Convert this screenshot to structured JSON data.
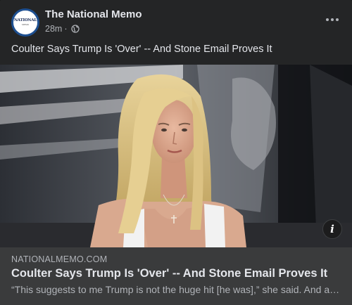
{
  "post": {
    "page_name": "The National Memo",
    "avatar_text": "NATIONAL",
    "avatar_subtext": "MEMO",
    "timestamp": "28m",
    "separator": "·",
    "audience_icon": "globe-icon",
    "more_icon": "more-horizontal-icon",
    "caption": "Coulter Says Trump Is 'Over' -- And Stone Email Proves It"
  },
  "link": {
    "domain": "NATIONALMEMO.COM",
    "title": "Coulter Says Trump Is 'Over' -- And Stone Email Proves It",
    "description": "“This suggests to me Trump is not the huge hit [he was],” she said. And a new email from Roger Stone shows his people know it.",
    "info_icon": "info-icon",
    "image_alt": "Woman with long blonde hair in a white top seated in a TV studio"
  },
  "colors": {
    "card_bg": "#242526",
    "link_meta_bg": "#3a3b3c",
    "primary_text": "#e4e6eb",
    "secondary_text": "#b0b3b8"
  }
}
